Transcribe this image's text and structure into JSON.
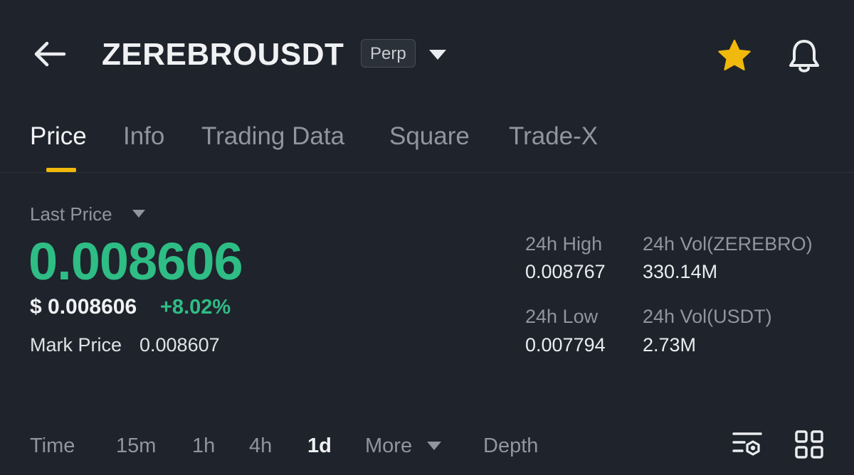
{
  "header": {
    "symbol": "ZEREBROUSDT",
    "badge": "Perp",
    "icons": {
      "back": "arrow-left-icon",
      "dropdown": "caret-down-icon",
      "favorite": "star-icon",
      "alert": "bell-icon"
    },
    "colors": {
      "favorite": "#f0b90b"
    }
  },
  "tabs": [
    {
      "label": "Price",
      "active": true
    },
    {
      "label": "Info"
    },
    {
      "label": "Trading Data"
    },
    {
      "label": "Square"
    },
    {
      "label": "Trade-X"
    }
  ],
  "price": {
    "label": "Last Price",
    "value": "0.008606",
    "usd": "$ 0.008606",
    "change": "+8.02%",
    "mark_label": "Mark Price",
    "mark_value": "0.008607",
    "colors": {
      "up": "#2ebd85"
    }
  },
  "stats": {
    "high_label": "24h High",
    "high_value": "0.008767",
    "vol_base_label": "24h Vol(ZEREBRO)",
    "vol_base_value": "330.14M",
    "low_label": "24h Low",
    "low_value": "0.007794",
    "vol_quote_label": "24h Vol(USDT)",
    "vol_quote_value": "2.73M"
  },
  "timeframes": {
    "items": [
      "Time",
      "15m",
      "1h",
      "4h",
      "1d",
      "More",
      "Depth"
    ],
    "active": "1d",
    "icons": {
      "settings": "chart-settings-icon",
      "grid": "grid-icon"
    }
  }
}
